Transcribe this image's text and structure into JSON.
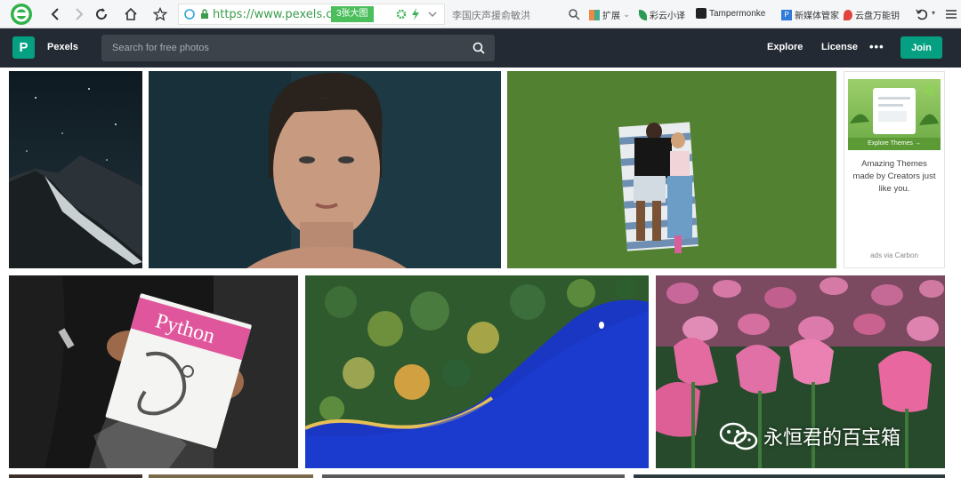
{
  "browser": {
    "url": "https://www.pexels.co",
    "zoom_badge": "3张大图",
    "search_hint": "李国庆声援俞敏洪",
    "bookmarks": [
      {
        "label": "扩展",
        "icon": "grid-icon"
      },
      {
        "label": "彩云小译",
        "icon": "leaf-icon"
      },
      {
        "label": "Tampermonke",
        "icon": "tampermonkey-icon"
      },
      {
        "label": "新媒体管家",
        "icon": "p-icon"
      },
      {
        "label": "云盘万能钥",
        "icon": "pin-icon"
      }
    ]
  },
  "header": {
    "brand": "Pexels",
    "search_placeholder": "Search for free photos",
    "nav_explore": "Explore",
    "nav_license": "License",
    "more": "•••",
    "join": "Join",
    "accent": "#05a081",
    "bg": "#232a34"
  },
  "ad": {
    "image_button": "Explore Themes →",
    "text": "Amazing Themes made by Creators just like you.",
    "via": "ads via Carbon"
  },
  "photos": {
    "book_title": "Python"
  },
  "watermark": {
    "text": "永恒君的百宝箱"
  }
}
